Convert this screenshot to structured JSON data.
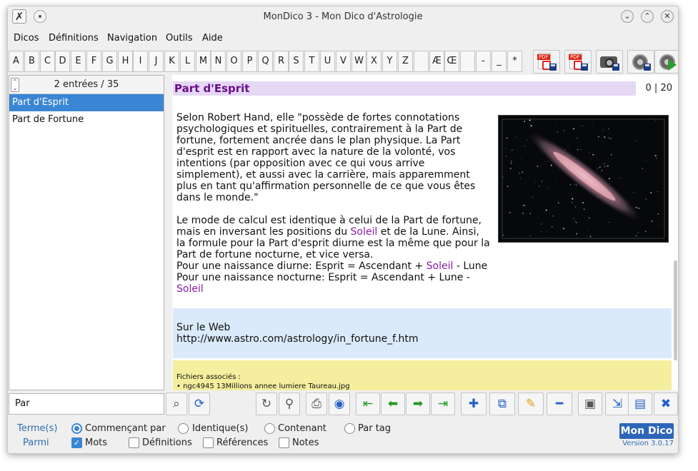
{
  "window": {
    "title": "MonDico 3 - Mon Dico d'Astrologie",
    "controls": {
      "minimize": "⌄",
      "maximize": "⌃",
      "close": "✕"
    }
  },
  "menu": [
    "Dicos",
    "Définitions",
    "Navigation",
    "Outils",
    "Aide"
  ],
  "alphabet": [
    "A",
    "B",
    "C",
    "D",
    "E",
    "F",
    "G",
    "H",
    "I",
    "J",
    "K",
    "L",
    "M",
    "N",
    "O",
    "P",
    "Q",
    "R",
    "S",
    "T",
    "U",
    "V",
    "W",
    "X",
    "Y",
    "Z",
    "",
    "Æ",
    "Œ",
    "",
    "-",
    "_",
    "*"
  ],
  "toolbar_icons": [
    "pdf-export-icon",
    "pdf-save-icon",
    "camera-icon",
    "speaker-save-icon",
    "speaker-play-icon"
  ],
  "list": {
    "count": "2 entrées / 35",
    "items": [
      "Part d'Esprit",
      "Part de Fortune"
    ],
    "selected_index": 0
  },
  "entry": {
    "title": "Part d'Esprit",
    "position": "0 | 20",
    "p1": "Selon Robert Hand, elle \"possède de fortes connotations psychologiques et spirituelles, contrairement à la Part de fortune, fortement ancrée dans le plan physique. La Part d'esprit est en rapport avec la nature de la volonté, vos intentions (par opposition avec ce qui vous arrive simplement), et aussi avec la carrière, mais apparemment plus en tant qu'affirmation personnelle de ce que vous êtes dans le monde.\"",
    "p2a": "Le mode de calcul est identique à celui de la Part de fortune, mais en inversant les positions du ",
    "soleil": "Soleil",
    "p2b": " et de la Lune. Ainsi, la formule pour la Part d'esprit diurne est la même que pour la Part de fortune nocturne, et vice versa.",
    "l3a": "Pour une naissance diurne: Esprit = Ascendant + ",
    "l3b": " - Lune",
    "l4a": "Pour une naissance nocturne: Esprit = Ascendant + Lune - ",
    "web_label": "Sur le Web",
    "web_url": "http://www.astro.com/astrology/in_fortune_f.htm",
    "files_label": "Fichiers associés :",
    "files_item": "• ngc4945 13Millions annee lumiere Taureau.jpg"
  },
  "search": {
    "value": "Par"
  },
  "toolbar_glyphs": {
    "find": "⌕",
    "refresh": "⟳",
    "reload": "↻",
    "zoom": "⚲",
    "print": "⎙",
    "globe": "◉",
    "first": "⇤",
    "prev": "⬅",
    "next": "➡",
    "last": "⇥",
    "add": "✚",
    "duplicate": "⧉",
    "edit": "✎",
    "remove": "━",
    "save": "▣",
    "export": "⇲",
    "books": "▤",
    "tools": "✖"
  },
  "options": {
    "terms_label": "Terme(s)",
    "among_label": "Parmi",
    "radios": [
      {
        "label": "Commençant par",
        "checked": true
      },
      {
        "label": "Identique(s)",
        "checked": false
      },
      {
        "label": "Contenant",
        "checked": false
      },
      {
        "label": "Par tag",
        "checked": false
      }
    ],
    "checks": [
      {
        "label": "Mots",
        "checked": true
      },
      {
        "label": "Définitions",
        "checked": false
      },
      {
        "label": "Références",
        "checked": false
      },
      {
        "label": "Notes",
        "checked": false
      }
    ],
    "checkmark": "✓"
  },
  "branding": {
    "logo": "Mon Dico",
    "version": "Version 3.0.17"
  },
  "colors": {
    "accent": "#3b86d4",
    "title_bg": "#e4d8f5",
    "title_fg": "#6a0f8a",
    "web_bg": "#dbeafa",
    "files_bg": "#f4ee9e",
    "link_purple": "#8b1da6"
  }
}
